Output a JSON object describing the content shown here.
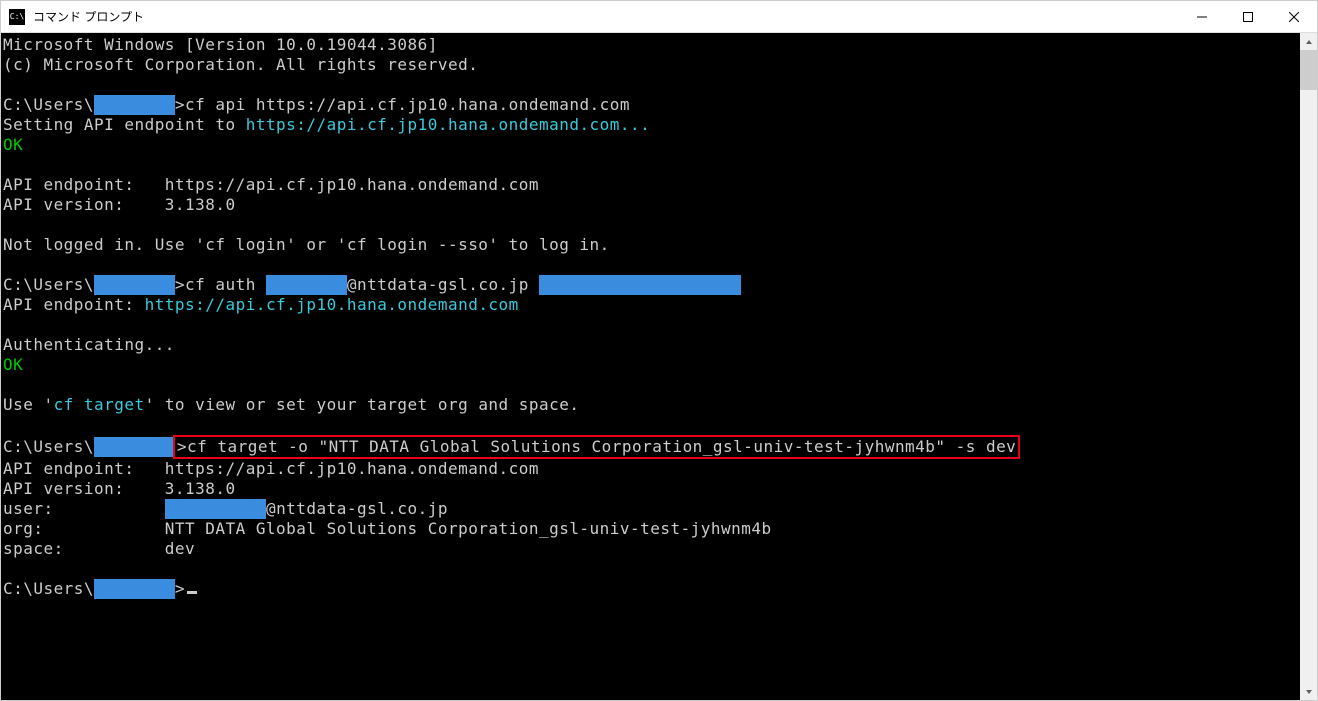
{
  "window": {
    "app_icon_text": "C:\\",
    "title": "コマンド プロンプト"
  },
  "colors": {
    "redact_bg": "#3a8dde",
    "ok": "#00c800",
    "link": "#3bc9db",
    "highlight_border": "#e8001a"
  },
  "terminal": {
    "l1": "Microsoft Windows [Version 10.0.19044.3086]",
    "l2": "(c) Microsoft Corporation. All rights reserved.",
    "blank": "",
    "prompt_prefix": "C:\\Users\\",
    "prompt_gt": ">",
    "redact_short": "       ",
    "redact_med": "        ",
    "redact_long": "          ",
    "redact_xl": "                    ",
    "cmd1": "cf api https://api.cf.jp10.hana.ondemand.com",
    "l4a": "Setting API endpoint to ",
    "l4b": "https://api.cf.jp10.hana.ondemand.com...",
    "ok": "OK",
    "l6": "API endpoint:   https://api.cf.jp10.hana.ondemand.com",
    "l7": "API version:    3.138.0",
    "l8": "Not logged in. Use 'cf login' or 'cf login --sso' to log in.",
    "cmd2a": "cf auth ",
    "cmd2b": "@nttdata-gsl.co.jp ",
    "l10a": "API endpoint: ",
    "l10b": "https://api.cf.jp10.hana.ondemand.com",
    "l11": "Authenticating...",
    "l12a": "Use '",
    "l12b": "cf target",
    "l12c": "' to view or set your target org and space.",
    "cmd3": "cf target -o \"NTT DATA Global Solutions Corporation_gsl-univ-test-jyhwnm4b\" -s dev",
    "l14": "API endpoint:   https://api.cf.jp10.hana.ondemand.com",
    "l15": "API version:    3.138.0",
    "l16a": "user:           ",
    "l16b": "@nttdata-gsl.co.jp",
    "l17": "org:            NTT DATA Global Solutions Corporation_gsl-univ-test-jyhwnm4b",
    "l18": "space:          dev"
  }
}
